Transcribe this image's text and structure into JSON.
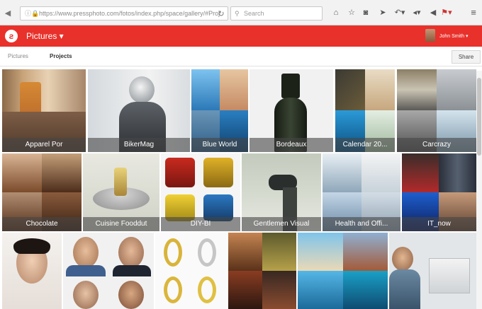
{
  "browser": {
    "url": "https://www.pressphoto.com/fotos/index.php/space/gallery/#Proj",
    "search_placeholder": "Search"
  },
  "app": {
    "title": "Pictures ▾",
    "user": "John Smith ▾"
  },
  "tabs": [
    "Pictures",
    "Projects"
  ],
  "share_label": "Share",
  "tiles": [
    {
      "label": "Apparel Por"
    },
    {
      "label": "BikerMag"
    },
    {
      "label": "Blue World"
    },
    {
      "label": "Bordeaux"
    },
    {
      "label": "Calendar 20..."
    },
    {
      "label": "Carcrazy"
    },
    {
      "label": "Chocolate"
    },
    {
      "label": "Cuisine Fooddut"
    },
    {
      "label": "DIY-BI"
    },
    {
      "label": "Gentlemen Visual"
    },
    {
      "label": "Health and Offi..."
    },
    {
      "label": "IT_now"
    },
    {
      "label": ""
    },
    {
      "label": ""
    },
    {
      "label": ""
    },
    {
      "label": ""
    },
    {
      "label": ""
    },
    {
      "label": ""
    }
  ]
}
